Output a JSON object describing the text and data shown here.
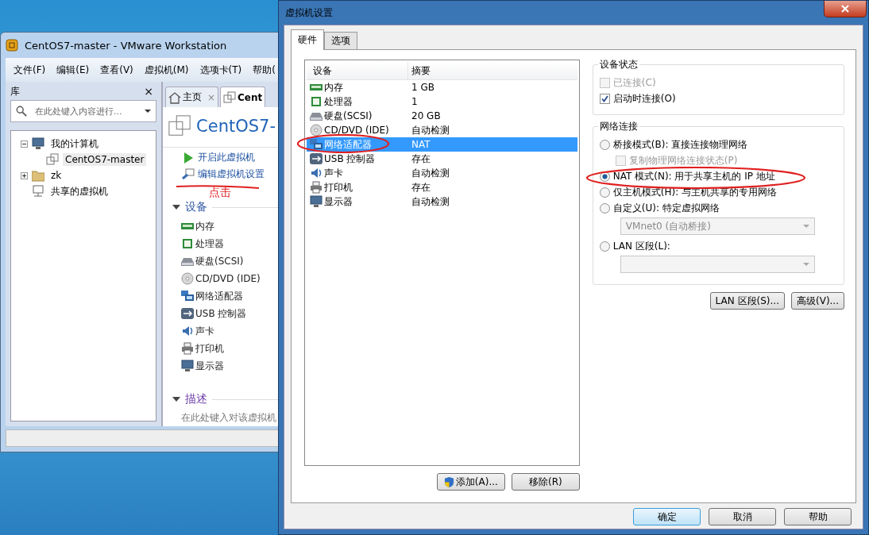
{
  "back_window": {
    "title": "CentOS7-master - VMware Workstation",
    "menu": [
      "文件(F)",
      "编辑(E)",
      "查看(V)",
      "虚拟机(M)",
      "选项卡(T)",
      "帮助("
    ],
    "library": {
      "title": "库",
      "close": "×",
      "search": {
        "placeholder": "在此处键入内容进行..."
      },
      "tree": [
        {
          "label": "我的计算机",
          "expanded": true,
          "selected": false,
          "children": [
            {
              "label": "CentOS7-master",
              "selected": true
            }
          ]
        },
        {
          "label": "zk",
          "expanded": false,
          "selected": false
        },
        {
          "label": "共享的虚拟机",
          "selected": false
        }
      ]
    },
    "tabs": [
      {
        "label": "主页",
        "close": "×",
        "selected": false
      },
      {
        "label": "Cent",
        "selected": true
      }
    ],
    "vm_title": "CentOS7-",
    "actions": [
      "开启此虚拟机",
      "编辑虚拟机设置"
    ],
    "annotation": "点击",
    "devices_heading": "设备",
    "devices": [
      "内存",
      "处理器",
      "硬盘(SCSI)",
      "CD/DVD (IDE)",
      "网络适配器",
      "USB 控制器",
      "声卡",
      "打印机",
      "显示器"
    ],
    "description_heading": "描述",
    "description_placeholder": "在此处键入对该虚拟机"
  },
  "dialog": {
    "title": "虚拟机设置",
    "tabs": [
      {
        "label": "硬件",
        "selected": true
      },
      {
        "label": "选项",
        "selected": false
      }
    ],
    "table": {
      "columns": [
        "设备",
        "摘要"
      ],
      "rows": [
        {
          "device": "内存",
          "summary": "1 GB",
          "selected": false
        },
        {
          "device": "处理器",
          "summary": "1",
          "selected": false
        },
        {
          "device": "硬盘(SCSI)",
          "summary": "20 GB",
          "selected": false
        },
        {
          "device": "CD/DVD (IDE)",
          "summary": "自动检测",
          "selected": false
        },
        {
          "device": "网络适配器",
          "summary": "NAT",
          "selected": true
        },
        {
          "device": "USB 控制器",
          "summary": "存在",
          "selected": false
        },
        {
          "device": "声卡",
          "summary": "自动检测",
          "selected": false
        },
        {
          "device": "打印机",
          "summary": "存在",
          "selected": false
        },
        {
          "device": "显示器",
          "summary": "自动检测",
          "selected": false
        }
      ]
    },
    "list_buttons": [
      "添加(A)...",
      "移除(R)"
    ],
    "device_status": {
      "title": "设备状态",
      "options": [
        {
          "label": "已连接(C)",
          "checked": false,
          "disabled": true
        },
        {
          "label": "启动时连接(O)",
          "checked": true,
          "disabled": false
        }
      ]
    },
    "network": {
      "title": "网络连接",
      "options": [
        {
          "kind": "radio",
          "label": "桥接模式(B): 直接连接物理网络",
          "selected": false
        },
        {
          "kind": "checkbox",
          "label": "复制物理网络连接状态(P)",
          "checked": false,
          "disabled": true
        },
        {
          "kind": "radio",
          "label": "NAT 模式(N): 用于共享主机的 IP 地址",
          "selected": true
        },
        {
          "kind": "radio",
          "label": "仅主机模式(H): 与主机共享的专用网络",
          "selected": false
        },
        {
          "kind": "radio",
          "label": "自定义(U): 特定虚拟网络",
          "selected": false
        },
        {
          "kind": "select",
          "value": "VMnet0 (自动桥接)",
          "disabled": true
        },
        {
          "kind": "radio",
          "label": "LAN 区段(L):",
          "selected": false
        },
        {
          "kind": "select",
          "disabled": true
        }
      ]
    },
    "network_buttons": [
      "LAN 区段(S)...",
      "高级(V)..."
    ],
    "footer_buttons": [
      {
        "label": "确定",
        "default": true
      },
      {
        "label": "取消",
        "default": false
      },
      {
        "label": "帮助",
        "default": false
      }
    ]
  }
}
